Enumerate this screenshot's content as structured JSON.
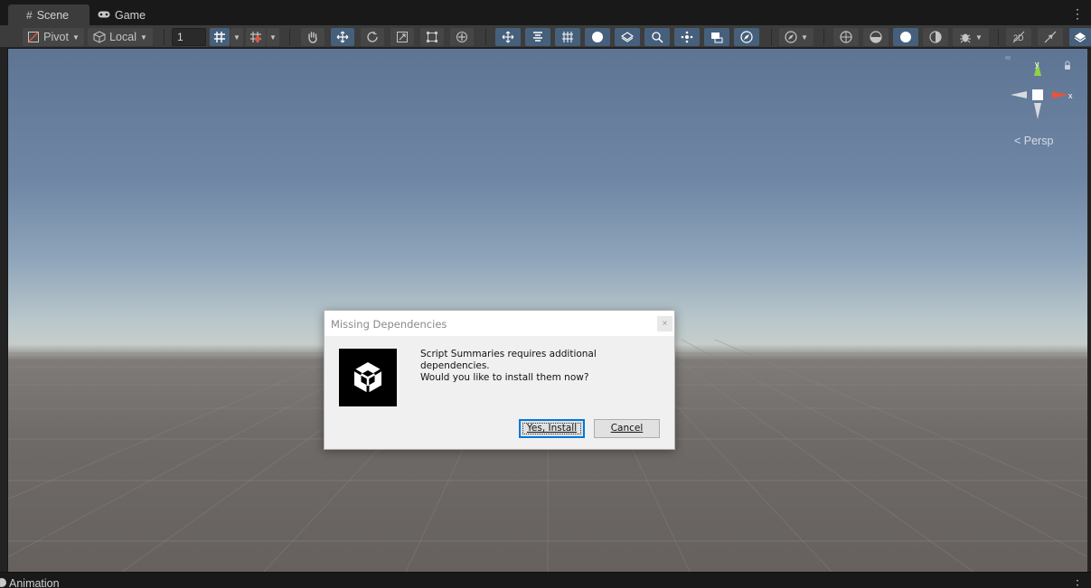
{
  "tabs": {
    "scene": "Scene",
    "game": "Game"
  },
  "toolbar": {
    "pivot": "Pivot",
    "local": "Local",
    "grid_size": "1"
  },
  "viewport": {
    "projection_label": "< Persp",
    "axis_x": "x"
  },
  "bottom_panel": {
    "title": "Animation"
  },
  "dialog": {
    "title": "Missing Dependencies",
    "close_glyph": "×",
    "message_line1": "Script Summaries requires additional dependencies.",
    "message_line2": "Would you like to install them now?",
    "yes_button": "Yes, Install",
    "cancel_button": "Cancel"
  },
  "colors": {
    "panel_bg": "#3c3c3c",
    "selected_tool": "#46607c",
    "dialog_focus": "#0078d7",
    "gizmo_y": "#8ed246",
    "gizmo_x": "#e4553e"
  }
}
